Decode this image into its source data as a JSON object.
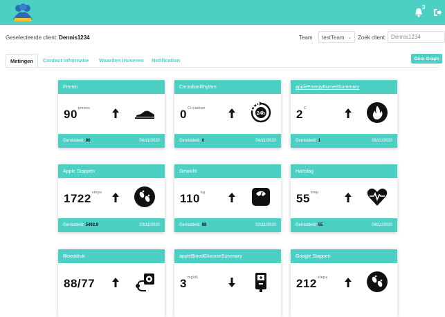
{
  "header": {
    "notification_count": "3"
  },
  "client_bar": {
    "label": "Geselecteerde client:",
    "client_name": "Dennis1234",
    "team_label": "Team",
    "team_value": "testTeam",
    "search_label": "Zoek client:",
    "search_value": "Dennis1234"
  },
  "tabs": [
    {
      "label": "Metingen"
    },
    {
      "label": "Contact informatie"
    },
    {
      "label": "Waarden invoeren"
    },
    {
      "label": "Notification"
    }
  ],
  "goto_button": "Goto Graph",
  "avg_label": "Gemiddeld:",
  "cards": [
    {
      "title": "Pmmis",
      "value": "90",
      "unit": "pmmis",
      "trend": "up",
      "icon": "shoe-icon",
      "average": "90",
      "date": "04/11/2020"
    },
    {
      "title": "CircadianRhythm",
      "value": "0",
      "unit": "Circadian",
      "trend": "up",
      "icon": "24h-cycle-icon",
      "average": "0",
      "date": "04/11/2020"
    },
    {
      "title": "appleEnergyBurnedSummary",
      "value": "2",
      "unit": "C",
      "trend": "up",
      "icon": "flame-icon",
      "average": "1",
      "date": "05/11/2020"
    },
    {
      "title": "Apple Stappen",
      "value": "1722",
      "unit": "steps",
      "trend": "up",
      "icon": "footsteps-icon",
      "average": "5492.9",
      "date": "23/11/2020"
    },
    {
      "title": "Gewicht",
      "value": "110",
      "unit": "kg",
      "trend": "up",
      "icon": "scale-icon",
      "average": "88",
      "date": "02/11/2020"
    },
    {
      "title": "Hartslag",
      "value": "55",
      "unit": "bmp",
      "trend": "up",
      "icon": "heartbeat-icon",
      "average": "55",
      "date": "04/11/2020"
    },
    {
      "title": "Bloeddruk",
      "value": "88/77",
      "unit": "",
      "trend": "up",
      "icon": "blood-pressure-icon"
    },
    {
      "title": "appleBloodGlucoseSummary",
      "value": "3",
      "unit": "mg/dL",
      "trend": "down",
      "icon": "glucose-meter-icon"
    },
    {
      "title": "Google Stappen",
      "value": "212",
      "unit": "steps",
      "trend": "up",
      "icon": "footsteps-icon"
    }
  ]
}
